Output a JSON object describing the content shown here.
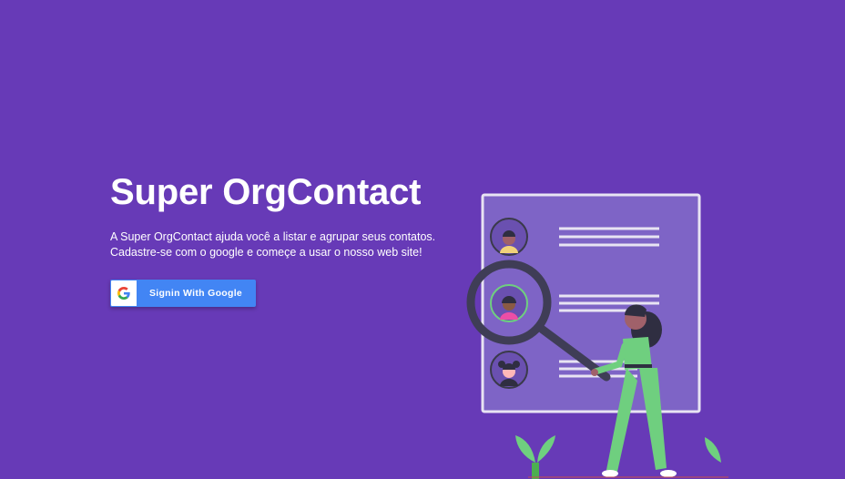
{
  "hero": {
    "title": "Super OrgContact",
    "description": "A Super OrgContact ajuda você a listar e agrupar seus contatos. Cadastre-se com o google e começe a usar o nosso web site!",
    "signin_button_label": "Signin With Google"
  },
  "colors": {
    "background": "#673ab7",
    "google_button": "#4285f4",
    "card_fill": "#7e64c6",
    "person_shirt": "#6fcf7f",
    "highlight_contact": "#ec4ea6"
  },
  "icons": {
    "google": "google-g-logo",
    "illustration": "woman-with-magnifying-glass-searching-contacts"
  }
}
